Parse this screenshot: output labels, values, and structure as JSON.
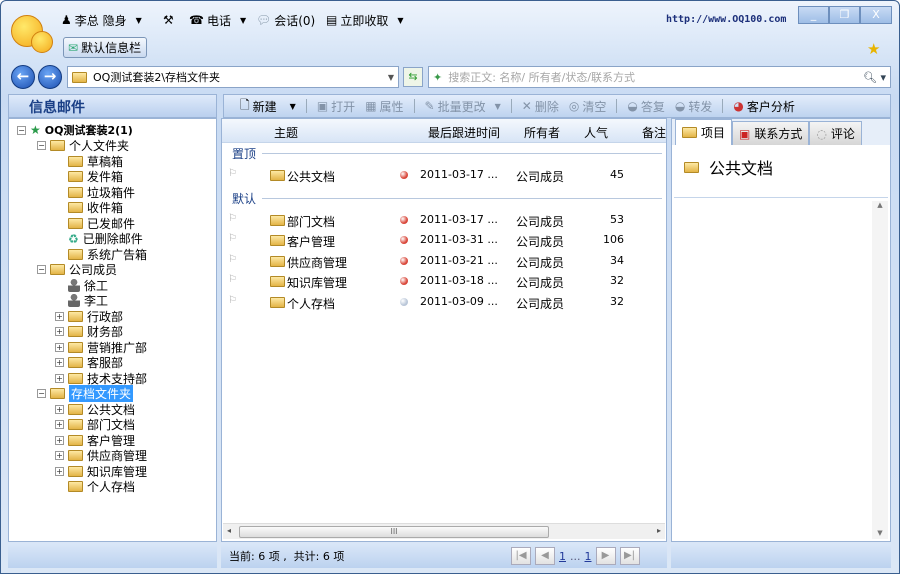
{
  "title_bar": {
    "user": "李总 隐身",
    "tools": "tools",
    "phone": "电话",
    "chat": "会话(0)",
    "receive": "立即收取",
    "url": "http://www.OQ100.com",
    "window_buttons": [
      "_",
      "❐",
      "X"
    ]
  },
  "info_bar_button": "默认信息栏",
  "address": {
    "path": "OQ测试套装2\\存档文件夹"
  },
  "search": {
    "placeholder": "搜索正文: 名称/ 所有者/状态/联系方式"
  },
  "left_panel": {
    "title": "信息邮件",
    "tree": [
      {
        "label": "OQ测试套装2(1)",
        "level": 0,
        "expander": "-",
        "icon": "star-icon",
        "bold": true
      },
      {
        "label": "个人文件夹",
        "level": 1,
        "expander": "-",
        "icon": "personal-folder-icon"
      },
      {
        "label": "草稿箱",
        "level": 2,
        "icon": "drafts-icon"
      },
      {
        "label": "发件箱",
        "level": 2,
        "icon": "outbox-icon"
      },
      {
        "label": "垃圾箱件",
        "level": 2,
        "icon": "junk-icon"
      },
      {
        "label": "收件箱",
        "level": 2,
        "icon": "inbox-icon"
      },
      {
        "label": "已发邮件",
        "level": 2,
        "icon": "sent-icon"
      },
      {
        "label": "已删除邮件",
        "level": 2,
        "icon": "recycle-bin-icon"
      },
      {
        "label": "系统广告箱",
        "level": 2,
        "icon": "open-folder-icon"
      },
      {
        "label": "公司成员",
        "level": 1,
        "expander": "-",
        "icon": "group-folder-icon"
      },
      {
        "label": "徐工",
        "level": 2,
        "icon": "person-icon"
      },
      {
        "label": "李工",
        "level": 2,
        "icon": "person-icon"
      },
      {
        "label": "行政部",
        "level": 2,
        "expander": "+",
        "icon": "group-folder-icon"
      },
      {
        "label": "财务部",
        "level": 2,
        "expander": "+",
        "icon": "group-folder-icon"
      },
      {
        "label": "营销推广部",
        "level": 2,
        "expander": "+",
        "icon": "group-folder-icon"
      },
      {
        "label": "客服部",
        "level": 2,
        "expander": "+",
        "icon": "group-folder-icon"
      },
      {
        "label": "技术支持部",
        "level": 2,
        "expander": "+",
        "icon": "group-folder-icon"
      },
      {
        "label": "存档文件夹",
        "level": 1,
        "expander": "-",
        "icon": "open-folder-icon",
        "selected": true
      },
      {
        "label": "公共文档",
        "level": 2,
        "expander": "+",
        "icon": "folder-icon"
      },
      {
        "label": "部门文档",
        "level": 2,
        "expander": "+",
        "icon": "folder-icon"
      },
      {
        "label": "客户管理",
        "level": 2,
        "expander": "+",
        "icon": "folder-icon"
      },
      {
        "label": "供应商管理",
        "level": 2,
        "expander": "+",
        "icon": "folder-icon"
      },
      {
        "label": "知识库管理",
        "level": 2,
        "expander": "+",
        "icon": "folder-icon"
      },
      {
        "label": "个人存档",
        "level": 2,
        "icon": "folder-icon"
      }
    ]
  },
  "toolbar": {
    "new": "新建",
    "open": "打开",
    "props": "属性",
    "batch": "批量更改",
    "delete": "删除",
    "clear": "清空",
    "reply": "答复",
    "forward": "转发",
    "analysis": "客户分析"
  },
  "list": {
    "columns": {
      "subject": "主题",
      "last_time": "最后跟进时间",
      "owner": "所有者",
      "popularity": "人气",
      "note": "备注"
    },
    "groups": [
      {
        "name": "置顶",
        "rows": [
          {
            "subject": "公共文档",
            "status": "red",
            "time": "2011-03-17 ...",
            "owner": "公司成员",
            "popularity": "45"
          }
        ]
      },
      {
        "name": "默认",
        "rows": [
          {
            "subject": "部门文档",
            "status": "red",
            "time": "2011-03-17 ...",
            "owner": "公司成员",
            "popularity": "53"
          },
          {
            "subject": "客户管理",
            "status": "red",
            "time": "2011-03-31 ...",
            "owner": "公司成员",
            "popularity": "106"
          },
          {
            "subject": "供应商管理",
            "status": "red",
            "time": "2011-03-21 ...",
            "owner": "公司成员",
            "popularity": "34"
          },
          {
            "subject": "知识库管理",
            "status": "red",
            "time": "2011-03-18 ...",
            "owner": "公司成员",
            "popularity": "32"
          },
          {
            "subject": "个人存档",
            "status": "gray",
            "time": "2011-03-09 ...",
            "owner": "公司成员",
            "popularity": "32"
          }
        ]
      }
    ]
  },
  "status": {
    "text": "当前: 6 项 ,  共计: 6 项",
    "page_current": "1",
    "ellipsis": "...",
    "page_last": "1"
  },
  "right_panel": {
    "tabs": [
      "项目",
      "联系方式",
      "评论"
    ],
    "active_tab": 0,
    "title": "公共文档"
  },
  "colors": {
    "status_red": "#d9473a",
    "status_gray": "#b9c6d8",
    "selection": "#3399ff",
    "header_text": "#1a3f86"
  }
}
